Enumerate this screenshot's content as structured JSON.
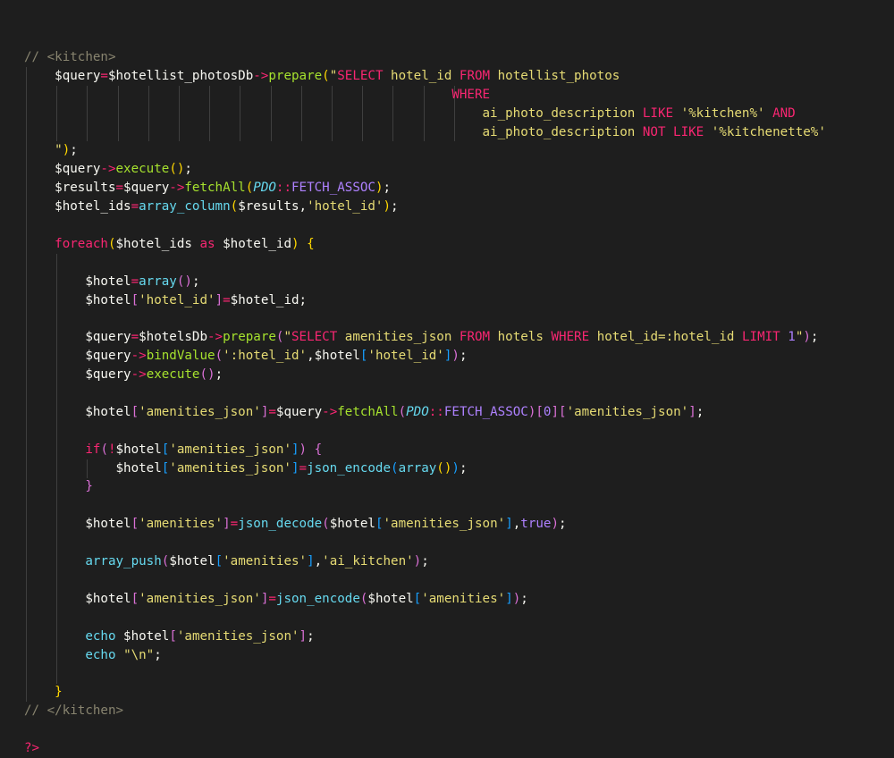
{
  "theme": {
    "background": "#1e1e1e",
    "comment": "#88846f",
    "function": "#a6e22e",
    "string": "#e6db74",
    "keyword": "#f92672",
    "constant": "#ae81ff",
    "class": "#66d9ef",
    "bracket_gold": "#ffd700",
    "bracket_purple": "#da70d6",
    "bracket_blue": "#179fff"
  },
  "code_lines": [
    [
      {
        "c": "comment",
        "t": "// <kitchen>"
      }
    ],
    [
      {
        "c": "text",
        "t": "    $query"
      },
      {
        "c": "op",
        "t": "="
      },
      {
        "c": "text",
        "t": "$hotellist_photosDb"
      },
      {
        "c": "op",
        "t": "->"
      },
      {
        "c": "fn",
        "t": "prepare"
      },
      {
        "c": "brk",
        "t": "("
      },
      {
        "c": "str",
        "t": "\""
      },
      {
        "c": "kw",
        "t": "SELECT"
      },
      {
        "c": "str",
        "t": " hotel_id "
      },
      {
        "c": "kw",
        "t": "FROM"
      },
      {
        "c": "str",
        "t": " hotellist_photos"
      }
    ],
    [
      {
        "c": "str",
        "t": "                                                        "
      },
      {
        "c": "kw",
        "t": "WHERE"
      }
    ],
    [
      {
        "c": "str",
        "t": "                                                            ai_photo_description "
      },
      {
        "c": "kw",
        "t": "LIKE"
      },
      {
        "c": "str",
        "t": " '%kitchen%' "
      },
      {
        "c": "kw",
        "t": "AND"
      }
    ],
    [
      {
        "c": "str",
        "t": "                                                            ai_photo_description "
      },
      {
        "c": "kw",
        "t": "NOT LIKE"
      },
      {
        "c": "str",
        "t": " '%kitchenette%'"
      }
    ],
    [
      {
        "c": "str",
        "t": "    \""
      },
      {
        "c": "brk",
        "t": ")"
      },
      {
        "c": "punc",
        "t": ";"
      }
    ],
    [
      {
        "c": "text",
        "t": "    $query"
      },
      {
        "c": "op",
        "t": "->"
      },
      {
        "c": "fn",
        "t": "execute"
      },
      {
        "c": "brk",
        "t": "()"
      },
      {
        "c": "punc",
        "t": ";"
      }
    ],
    [
      {
        "c": "text",
        "t": "    $results"
      },
      {
        "c": "op",
        "t": "="
      },
      {
        "c": "text",
        "t": "$query"
      },
      {
        "c": "op",
        "t": "->"
      },
      {
        "c": "fn",
        "t": "fetchAll"
      },
      {
        "c": "brk",
        "t": "("
      },
      {
        "c": "cls",
        "t": "PDO"
      },
      {
        "c": "op",
        "t": "::"
      },
      {
        "c": "const",
        "t": "FETCH_ASSOC"
      },
      {
        "c": "brk",
        "t": ")"
      },
      {
        "c": "punc",
        "t": ";"
      }
    ],
    [
      {
        "c": "text",
        "t": "    $hotel_ids"
      },
      {
        "c": "op",
        "t": "="
      },
      {
        "c": "builtin",
        "t": "array_column"
      },
      {
        "c": "brk",
        "t": "("
      },
      {
        "c": "text",
        "t": "$results,"
      },
      {
        "c": "str",
        "t": "'hotel_id'"
      },
      {
        "c": "brk",
        "t": ")"
      },
      {
        "c": "punc",
        "t": ";"
      }
    ],
    [],
    [
      {
        "c": "text",
        "t": "    "
      },
      {
        "c": "kw",
        "t": "foreach"
      },
      {
        "c": "brk",
        "t": "("
      },
      {
        "c": "text",
        "t": "$hotel_ids "
      },
      {
        "c": "kw",
        "t": "as"
      },
      {
        "c": "text",
        "t": " $hotel_id"
      },
      {
        "c": "brk",
        "t": ")"
      },
      {
        "c": "text",
        "t": " "
      },
      {
        "c": "brk",
        "t": "{"
      }
    ],
    [],
    [
      {
        "c": "text",
        "t": "        $hotel"
      },
      {
        "c": "op",
        "t": "="
      },
      {
        "c": "builtin",
        "t": "array"
      },
      {
        "c": "brk2",
        "t": "()"
      },
      {
        "c": "punc",
        "t": ";"
      }
    ],
    [
      {
        "c": "text",
        "t": "        $hotel"
      },
      {
        "c": "brk2",
        "t": "["
      },
      {
        "c": "str",
        "t": "'hotel_id'"
      },
      {
        "c": "brk2",
        "t": "]"
      },
      {
        "c": "op",
        "t": "="
      },
      {
        "c": "text",
        "t": "$hotel_id;"
      }
    ],
    [],
    [
      {
        "c": "text",
        "t": "        $query"
      },
      {
        "c": "op",
        "t": "="
      },
      {
        "c": "text",
        "t": "$hotelsDb"
      },
      {
        "c": "op",
        "t": "->"
      },
      {
        "c": "fn",
        "t": "prepare"
      },
      {
        "c": "brk2",
        "t": "("
      },
      {
        "c": "str",
        "t": "\""
      },
      {
        "c": "kw",
        "t": "SELECT"
      },
      {
        "c": "str",
        "t": " amenities_json "
      },
      {
        "c": "kw",
        "t": "FROM"
      },
      {
        "c": "str",
        "t": " hotels "
      },
      {
        "c": "kw",
        "t": "WHERE"
      },
      {
        "c": "str",
        "t": " hotel_id=:hotel_id "
      },
      {
        "c": "kw",
        "t": "LIMIT"
      },
      {
        "c": "str",
        "t": " "
      },
      {
        "c": "const",
        "t": "1"
      },
      {
        "c": "str",
        "t": "\""
      },
      {
        "c": "brk2",
        "t": ")"
      },
      {
        "c": "punc",
        "t": ";"
      }
    ],
    [
      {
        "c": "text",
        "t": "        $query"
      },
      {
        "c": "op",
        "t": "->"
      },
      {
        "c": "fn",
        "t": "bindValue"
      },
      {
        "c": "brk2",
        "t": "("
      },
      {
        "c": "str",
        "t": "':hotel_id'"
      },
      {
        "c": "text",
        "t": ",$hotel"
      },
      {
        "c": "brk3",
        "t": "["
      },
      {
        "c": "str",
        "t": "'hotel_id'"
      },
      {
        "c": "brk3",
        "t": "]"
      },
      {
        "c": "brk2",
        "t": ")"
      },
      {
        "c": "punc",
        "t": ";"
      }
    ],
    [
      {
        "c": "text",
        "t": "        $query"
      },
      {
        "c": "op",
        "t": "->"
      },
      {
        "c": "fn",
        "t": "execute"
      },
      {
        "c": "brk2",
        "t": "()"
      },
      {
        "c": "punc",
        "t": ";"
      }
    ],
    [],
    [
      {
        "c": "text",
        "t": "        $hotel"
      },
      {
        "c": "brk2",
        "t": "["
      },
      {
        "c": "str",
        "t": "'amenities_json'"
      },
      {
        "c": "brk2",
        "t": "]"
      },
      {
        "c": "op",
        "t": "="
      },
      {
        "c": "text",
        "t": "$query"
      },
      {
        "c": "op",
        "t": "->"
      },
      {
        "c": "fn",
        "t": "fetchAll"
      },
      {
        "c": "brk2",
        "t": "("
      },
      {
        "c": "cls",
        "t": "PDO"
      },
      {
        "c": "op",
        "t": "::"
      },
      {
        "c": "const",
        "t": "FETCH_ASSOC"
      },
      {
        "c": "brk2",
        "t": ")"
      },
      {
        "c": "brk2",
        "t": "["
      },
      {
        "c": "const",
        "t": "0"
      },
      {
        "c": "brk2",
        "t": "]["
      },
      {
        "c": "str",
        "t": "'amenities_json'"
      },
      {
        "c": "brk2",
        "t": "]"
      },
      {
        "c": "punc",
        "t": ";"
      }
    ],
    [],
    [
      {
        "c": "text",
        "t": "        "
      },
      {
        "c": "kw",
        "t": "if"
      },
      {
        "c": "brk2",
        "t": "("
      },
      {
        "c": "op",
        "t": "!"
      },
      {
        "c": "text",
        "t": "$hotel"
      },
      {
        "c": "brk3",
        "t": "["
      },
      {
        "c": "str",
        "t": "'amenities_json'"
      },
      {
        "c": "brk3",
        "t": "]"
      },
      {
        "c": "brk2",
        "t": ")"
      },
      {
        "c": "text",
        "t": " "
      },
      {
        "c": "brk2",
        "t": "{"
      }
    ],
    [
      {
        "c": "text",
        "t": "            $hotel"
      },
      {
        "c": "brk3",
        "t": "["
      },
      {
        "c": "str",
        "t": "'amenities_json'"
      },
      {
        "c": "brk3",
        "t": "]"
      },
      {
        "c": "op",
        "t": "="
      },
      {
        "c": "builtin",
        "t": "json_encode"
      },
      {
        "c": "brk3",
        "t": "("
      },
      {
        "c": "builtin",
        "t": "array"
      },
      {
        "c": "brk",
        "t": "()"
      },
      {
        "c": "brk3",
        "t": ")"
      },
      {
        "c": "punc",
        "t": ";"
      }
    ],
    [
      {
        "c": "text",
        "t": "        "
      },
      {
        "c": "brk2",
        "t": "}"
      }
    ],
    [],
    [
      {
        "c": "text",
        "t": "        $hotel"
      },
      {
        "c": "brk2",
        "t": "["
      },
      {
        "c": "str",
        "t": "'amenities'"
      },
      {
        "c": "brk2",
        "t": "]"
      },
      {
        "c": "op",
        "t": "="
      },
      {
        "c": "builtin",
        "t": "json_decode"
      },
      {
        "c": "brk2",
        "t": "("
      },
      {
        "c": "text",
        "t": "$hotel"
      },
      {
        "c": "brk3",
        "t": "["
      },
      {
        "c": "str",
        "t": "'amenities_json'"
      },
      {
        "c": "brk3",
        "t": "]"
      },
      {
        "c": "text",
        "t": ","
      },
      {
        "c": "const",
        "t": "true"
      },
      {
        "c": "brk2",
        "t": ")"
      },
      {
        "c": "punc",
        "t": ";"
      }
    ],
    [],
    [
      {
        "c": "text",
        "t": "        "
      },
      {
        "c": "builtin",
        "t": "array_push"
      },
      {
        "c": "brk2",
        "t": "("
      },
      {
        "c": "text",
        "t": "$hotel"
      },
      {
        "c": "brk3",
        "t": "["
      },
      {
        "c": "str",
        "t": "'amenities'"
      },
      {
        "c": "brk3",
        "t": "]"
      },
      {
        "c": "text",
        "t": ","
      },
      {
        "c": "str",
        "t": "'ai_kitchen'"
      },
      {
        "c": "brk2",
        "t": ")"
      },
      {
        "c": "punc",
        "t": ";"
      }
    ],
    [],
    [
      {
        "c": "text",
        "t": "        $hotel"
      },
      {
        "c": "brk2",
        "t": "["
      },
      {
        "c": "str",
        "t": "'amenities_json'"
      },
      {
        "c": "brk2",
        "t": "]"
      },
      {
        "c": "op",
        "t": "="
      },
      {
        "c": "builtin",
        "t": "json_encode"
      },
      {
        "c": "brk2",
        "t": "("
      },
      {
        "c": "text",
        "t": "$hotel"
      },
      {
        "c": "brk3",
        "t": "["
      },
      {
        "c": "str",
        "t": "'amenities'"
      },
      {
        "c": "brk3",
        "t": "]"
      },
      {
        "c": "brk2",
        "t": ")"
      },
      {
        "c": "punc",
        "t": ";"
      }
    ],
    [],
    [
      {
        "c": "text",
        "t": "        "
      },
      {
        "c": "builtin",
        "t": "echo"
      },
      {
        "c": "text",
        "t": " $hotel"
      },
      {
        "c": "brk2",
        "t": "["
      },
      {
        "c": "str",
        "t": "'amenities_json'"
      },
      {
        "c": "brk2",
        "t": "]"
      },
      {
        "c": "punc",
        "t": ";"
      }
    ],
    [
      {
        "c": "text",
        "t": "        "
      },
      {
        "c": "builtin",
        "t": "echo"
      },
      {
        "c": "text",
        "t": " "
      },
      {
        "c": "str",
        "t": "\"\\n\""
      },
      {
        "c": "punc",
        "t": ";"
      }
    ],
    [],
    [
      {
        "c": "text",
        "t": "    "
      },
      {
        "c": "brk",
        "t": "}"
      }
    ],
    [
      {
        "c": "comment",
        "t": "// </kitchen>"
      }
    ],
    [],
    [
      {
        "c": "kw",
        "t": "?>"
      }
    ]
  ]
}
